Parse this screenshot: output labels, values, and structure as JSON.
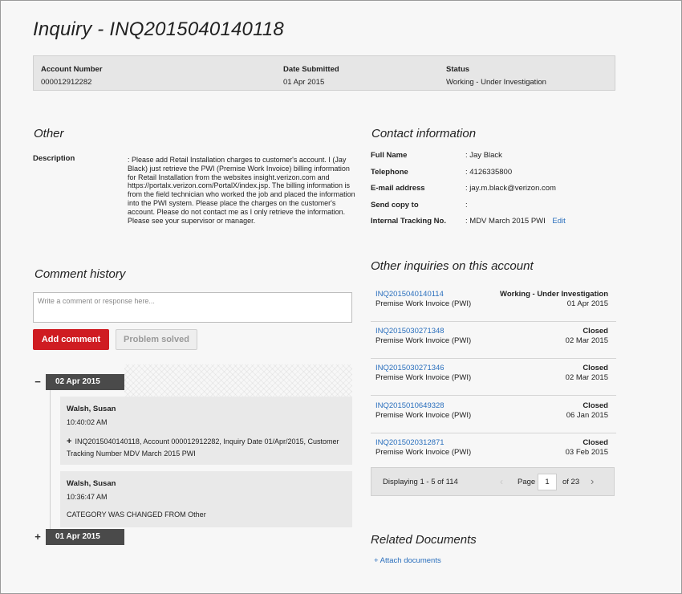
{
  "page": {
    "title": "Inquiry - INQ2015040140118"
  },
  "summary": {
    "account_label": "Account Number",
    "account_value": "000012912282",
    "date_label": "Date Submitted",
    "date_value": "01 Apr 2015",
    "status_label": "Status",
    "status_value": "Working - Under Investigation"
  },
  "other": {
    "title": "Other",
    "description_label": "Description",
    "description_text": ": Please add Retail Installation charges to customer's account. I (Jay Black) just retrieve the PWI (Premise Work Invoice) billing information for Retail Installation from the websites insight.verizon.com and https://portalx.verizon.com/PortalX/index.jsp. The billing information is from the field technician who worked the job and placed the information into the PWI system. Please place the charges on the customer's account. Please do not contact me as I only retrieve the information. Please see your supervisor or manager."
  },
  "contact": {
    "title": "Contact information",
    "fields": [
      {
        "label": "Full Name",
        "value": ": Jay Black"
      },
      {
        "label": "Telephone",
        "value": ": 4126335800"
      },
      {
        "label": "E-mail address",
        "value": ": jay.m.black@verizon.com"
      },
      {
        "label": "Send copy to",
        "value": ":"
      },
      {
        "label": "Internal Tracking No.",
        "value": ": MDV March 2015 PWI"
      }
    ],
    "edit_label": "Edit"
  },
  "comments": {
    "title": "Comment history",
    "placeholder": "Write a comment or response here...",
    "add_label": "Add comment",
    "solved_label": "Problem solved",
    "groups": [
      {
        "toggle": "−",
        "date": "02 Apr 2015",
        "entries": [
          {
            "author": "Walsh, Susan",
            "time": "10:40:02 AM",
            "plus": "+",
            "text": "INQ2015040140118, Account 000012912282, Inquiry Date 01/Apr/2015, Customer Tracking Number MDV March 2015 PWI"
          },
          {
            "author": "Walsh, Susan",
            "time": "10:36:47 AM",
            "text": "CATEGORY WAS CHANGED FROM Other"
          }
        ]
      },
      {
        "toggle": "+",
        "date": "01 Apr 2015"
      }
    ]
  },
  "other_inquiries": {
    "title": "Other inquiries on this account",
    "rows": [
      {
        "id": "INQ2015040140114",
        "type": "Premise Work Invoice (PWI)",
        "status": "Working - Under Investigation",
        "date": "01 Apr 2015"
      },
      {
        "id": "INQ2015030271348",
        "type": "Premise Work Invoice (PWI)",
        "status": "Closed",
        "date": "02 Mar 2015"
      },
      {
        "id": "INQ2015030271346",
        "type": "Premise Work Invoice (PWI)",
        "status": "Closed",
        "date": "02 Mar 2015"
      },
      {
        "id": "INQ2015010649328",
        "type": "Premise Work Invoice (PWI)",
        "status": "Closed",
        "date": "06 Jan 2015"
      },
      {
        "id": "INQ2015020312871",
        "type": "Premise Work Invoice (PWI)",
        "status": "Closed",
        "date": "03 Feb 2015"
      }
    ],
    "pager": {
      "displaying": "Displaying 1 - 5 of 114",
      "prev_icon": "‹",
      "page_label": "Page",
      "page_value": "1",
      "of_label": "of 23",
      "next_icon": "›"
    }
  },
  "related": {
    "title": "Related Documents",
    "attach_label": "+ Attach documents"
  },
  "colors": {
    "accent_red": "#cf1c22",
    "link_blue": "#2a6fbd",
    "timeline_dark": "#4a4a4a"
  }
}
